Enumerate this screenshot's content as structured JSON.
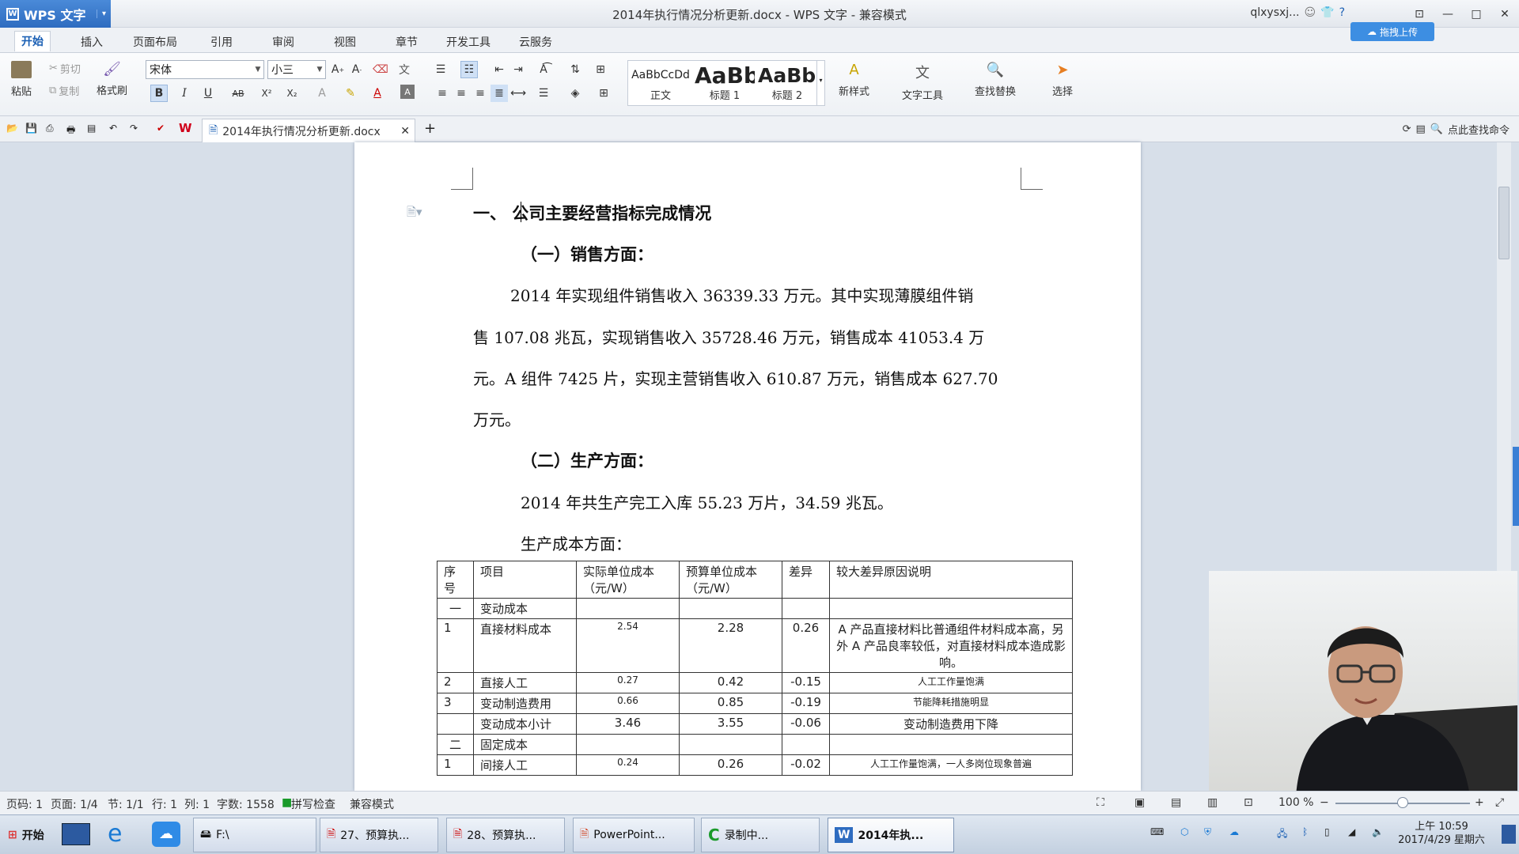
{
  "app": {
    "name": "WPS 文字",
    "window_title": "2014年执行情况分析更新.docx - WPS 文字 - 兼容模式",
    "user": "qlxysxj...",
    "drag_upload": "拖拽上传"
  },
  "ribbon_tabs": [
    "开始",
    "插入",
    "页面布局",
    "引用",
    "审阅",
    "视图",
    "章节",
    "开发工具",
    "云服务"
  ],
  "ribbon": {
    "paste": "粘贴",
    "cut": "剪切",
    "copy": "复制",
    "format_painter": "格式刷",
    "font": "宋体",
    "size": "小三",
    "bold": "B",
    "italic": "I",
    "underline": "U",
    "strike": "AB",
    "superscript": "X²",
    "subscript": "X₂",
    "styles": [
      {
        "sample": "AaBbCcDd",
        "label": "正文"
      },
      {
        "sample": "AaBb",
        "label": "标题 1"
      },
      {
        "sample": "AaBb(",
        "label": "标题 2"
      }
    ],
    "new_style": "新样式",
    "text_tools": "文字工具",
    "find_replace": "查找替换",
    "select": "选择"
  },
  "doc_tab": "2014年执行情况分析更新.docx",
  "find_command": "点此查找命令",
  "document": {
    "heading1": "一、 公司主要经营指标完成情况",
    "sub1": "（一）销售方面：",
    "p1_lines": [
      "2014 年实现组件销售收入 36339.33 万元。其中实现薄膜组件销",
      "售 107.08 兆瓦，实现销售收入 35728.46 万元，销售成本 41053.4 万",
      "元。A 组件 7425 片，实现主营销售收入 610.87 万元，销售成本 627.70",
      "万元。"
    ],
    "sub2": "（二）生产方面：",
    "p2": "2014 年共生产完工入库 55.23 万片，34.59 兆瓦。",
    "p3": "生产成本方面：",
    "table": {
      "headers": [
        "序号",
        "项目",
        "实际单位成本（元/W）",
        "预算单位成本（元/W）",
        "差异",
        "较大差异原因说明"
      ],
      "rows": [
        [
          "一",
          "变动成本",
          "",
          "",
          "",
          ""
        ],
        [
          "1",
          "直接材料成本",
          "2.54",
          "2.28",
          "0.26",
          "A 产品直接材料比普通组件材料成本高，另外 A 产品良率较低，对直接材料成本造成影响。"
        ],
        [
          "2",
          "直接人工",
          "0.27",
          "0.42",
          "-0.15",
          "人工工作量饱满"
        ],
        [
          "3",
          "变动制造费用",
          "0.66",
          "0.85",
          "-0.19",
          "节能降耗措施明显"
        ],
        [
          "",
          "变动成本小计",
          "3.46",
          "3.55",
          "-0.06",
          "变动制造费用下降"
        ],
        [
          "二",
          "固定成本",
          "",
          "",
          "",
          ""
        ],
        [
          "1",
          "间接人工",
          "0.24",
          "0.26",
          "-0.02",
          "人工工作量饱满，一人多岗位现象普遍"
        ]
      ]
    }
  },
  "status": {
    "page_code": "页码: 1",
    "pages": "页面: 1/4",
    "section": "节: 1/1",
    "row": "行: 1",
    "col": "列: 1",
    "words": "字数: 1558",
    "spell": "拼写检查",
    "compat": "兼容模式",
    "zoom": "100 %"
  },
  "taskbar": {
    "start": "开始",
    "items": [
      "F:\\",
      "27、预算执...",
      "28、预算执...",
      "PowerPoint...",
      "录制中...",
      "2014年执..."
    ],
    "time": "上午 10:59",
    "date": "2017/4/29 星期六"
  },
  "colors": {
    "accent": "#2e6cc0",
    "workspace": "#d7dfe9"
  }
}
